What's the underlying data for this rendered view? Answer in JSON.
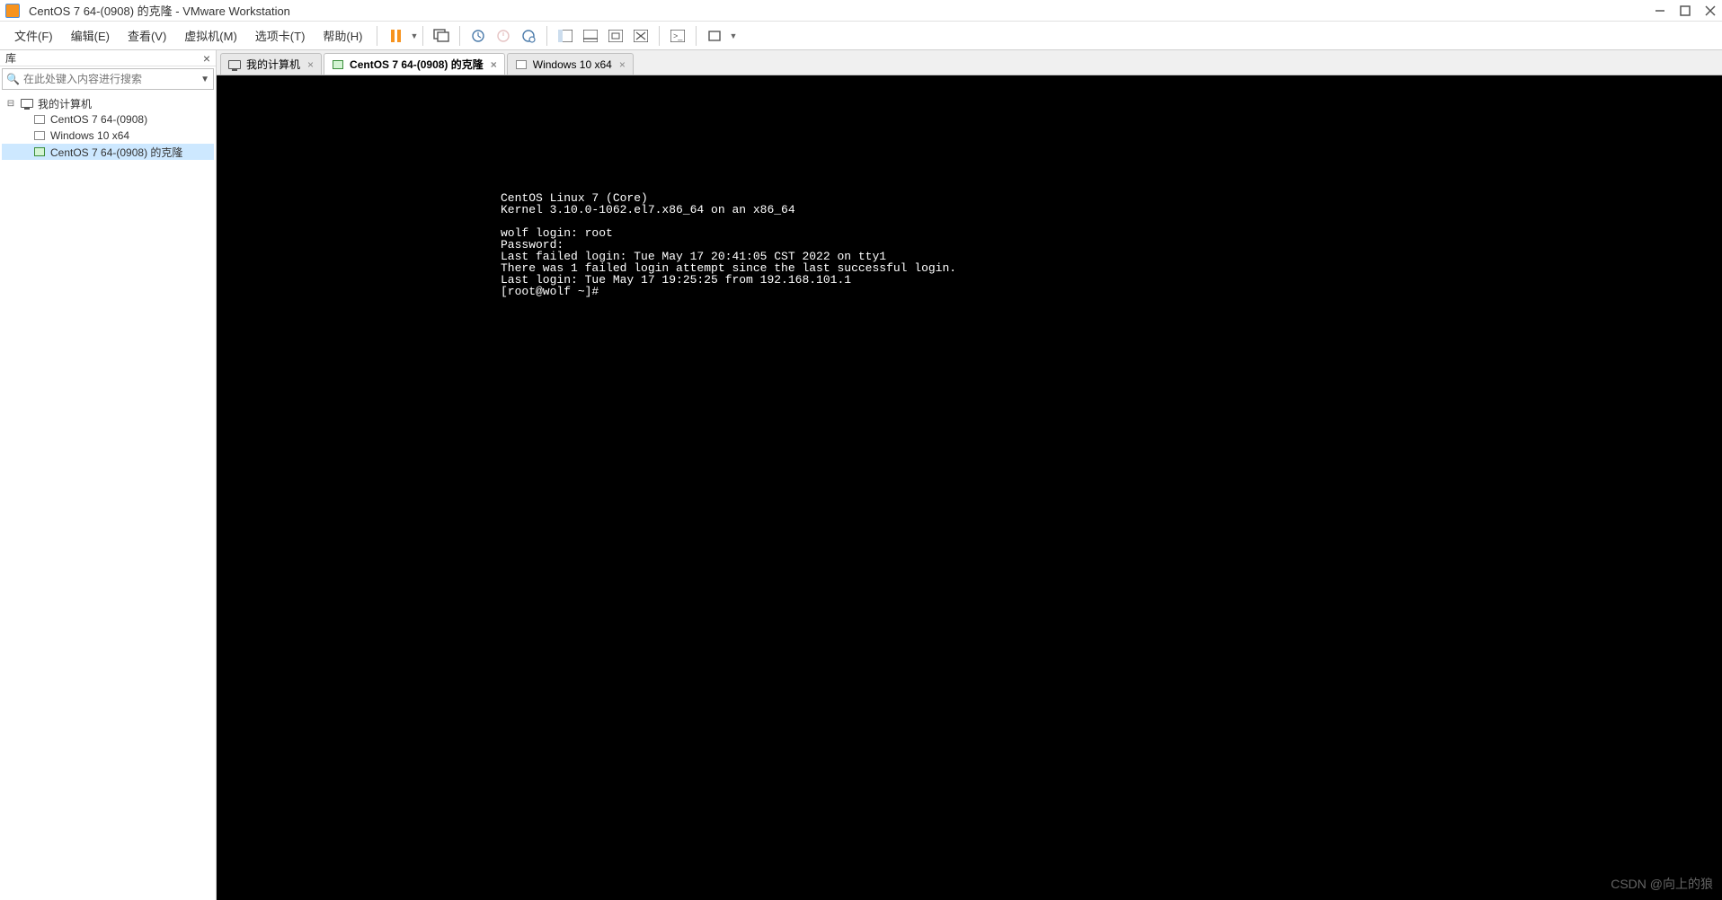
{
  "window": {
    "title": "CentOS 7 64-(0908) 的克隆 - VMware Workstation"
  },
  "menu": {
    "items": [
      "文件(F)",
      "编辑(E)",
      "查看(V)",
      "虚拟机(M)",
      "选项卡(T)",
      "帮助(H)"
    ]
  },
  "sidebar": {
    "title": "库",
    "search_placeholder": "在此处键入内容进行搜索",
    "tree": {
      "root": "我的计算机",
      "children": [
        "CentOS 7 64-(0908)",
        "Windows 10 x64",
        "CentOS 7 64-(0908) 的克隆"
      ]
    }
  },
  "tabs": [
    {
      "label": "我的计算机",
      "active": false
    },
    {
      "label": "CentOS 7 64-(0908) 的克隆",
      "active": true
    },
    {
      "label": "Windows 10 x64",
      "active": false
    }
  ],
  "terminal": {
    "lines": [
      "CentOS Linux 7 (Core)",
      "Kernel 3.10.0-1062.el7.x86_64 on an x86_64",
      "",
      "wolf login: root",
      "Password:",
      "Last failed login: Tue May 17 20:41:05 CST 2022 on tty1",
      "There was 1 failed login attempt since the last successful login.",
      "Last login: Tue May 17 19:25:25 from 192.168.101.1",
      "[root@wolf ~]#"
    ]
  },
  "watermark": "CSDN @向上的狼"
}
